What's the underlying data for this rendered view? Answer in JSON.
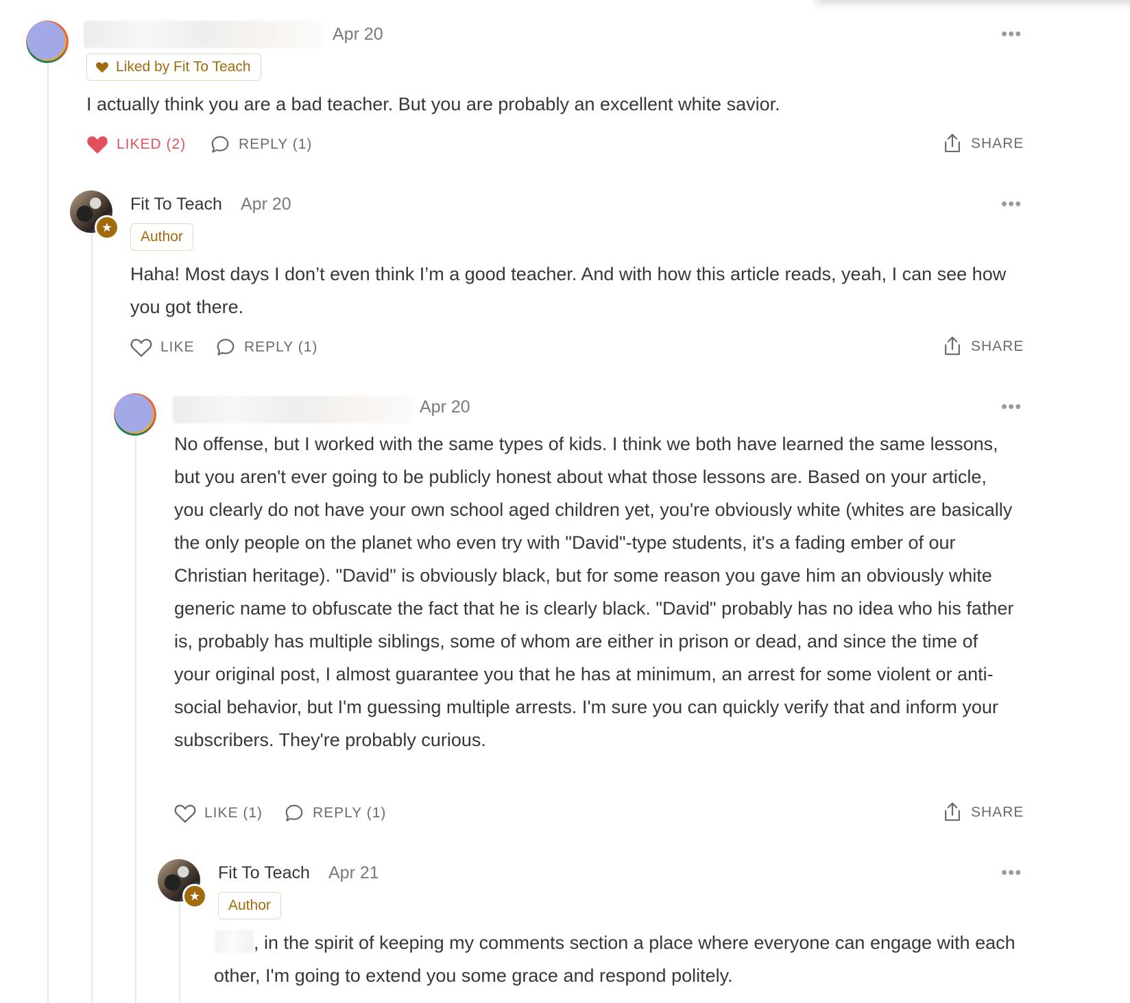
{
  "comments": [
    {
      "author": "",
      "date": "Apr 20",
      "liked_by_label": "Liked by Fit To Teach",
      "text": "I actually think you are a bad teacher. But you are probably an excellent white savior.",
      "like_label": "LIKED (2)",
      "reply_label": "REPLY (1)",
      "share_label": "SHARE",
      "liked": true
    },
    {
      "author": "Fit To Teach",
      "date": "Apr 20",
      "badge": "Author",
      "text": "Haha! Most days I don’t even think I’m a good teacher. And with how this article reads, yeah, I can see how you got there.",
      "like_label": "LIKE",
      "reply_label": "REPLY (1)",
      "share_label": "SHARE"
    },
    {
      "author": "",
      "date": "Apr 20",
      "text": "No offense, but I worked with the same types of kids. I think we both have learned the same lessons, but you aren't ever going to be publicly honest about what those lessons are. Based on your article, you clearly do not have your own school aged children yet, you're obviously white (whites are basically the only people on the planet who even try with \"David\"-type students, it's a fading ember of our Christian heritage). \"David\" is obviously black, but for some reason you gave him an obviously white generic name to obfuscate the fact that he is clearly black. \"David\" probably has no idea who his father is, probably has multiple siblings, some of whom are either in prison or dead, and since the time of your original post, I almost guarantee you that he has at minimum, an arrest for some violent or anti-social behavior, but I'm guessing multiple arrests. I'm sure you can quickly verify that and inform your subscribers. They're probably curious.",
      "like_label": "LIKE (1)",
      "reply_label": "REPLY (1)",
      "share_label": "SHARE"
    },
    {
      "author": "Fit To Teach",
      "date": "Apr 21",
      "badge": "Author",
      "text": ", in the spirit of keeping my comments section a place where everyone can engage with each other, I'm going to extend you some grace and respond politely."
    }
  ],
  "icons": {
    "more": "more-dots-icon",
    "heart_filled": "heart-filled-icon",
    "heart_outline": "heart-outline-icon",
    "reply": "speech-bubble-icon",
    "share": "share-icon",
    "star": "star-icon"
  },
  "colors": {
    "liked": "#e2515b",
    "author_accent": "#a06a0d",
    "muted_text": "#6b6b6b",
    "thread_line": "#e6e6e6"
  }
}
